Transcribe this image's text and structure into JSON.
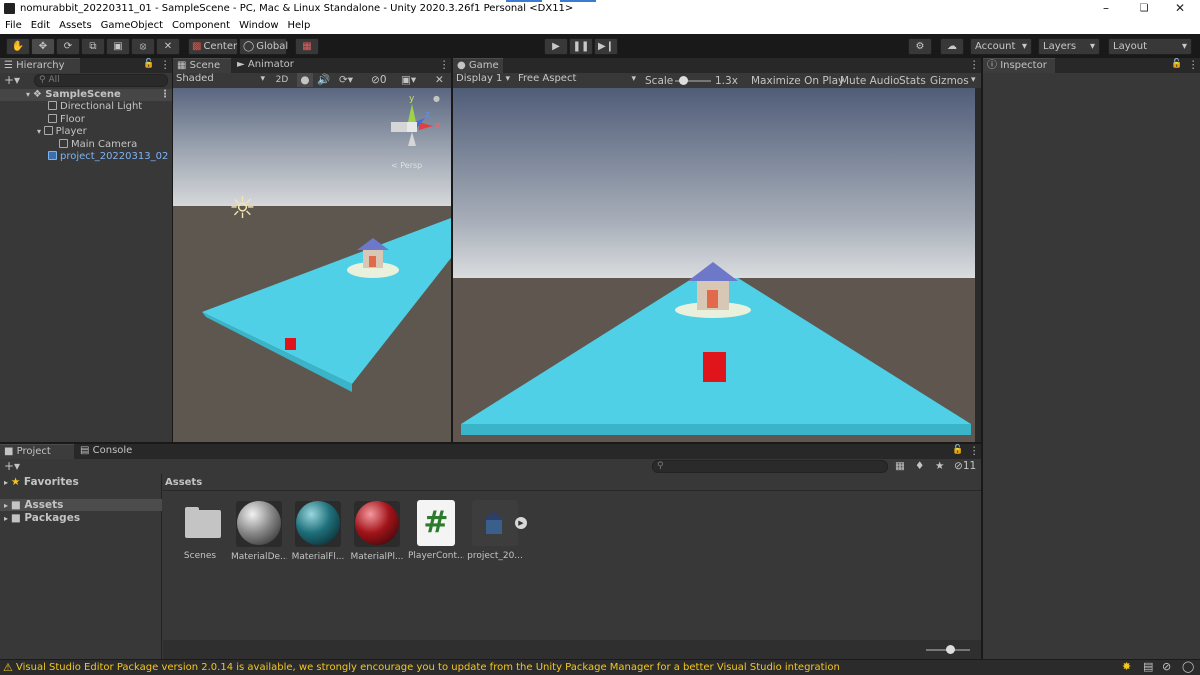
{
  "window": {
    "title": "nomurabbit_20220311_01 - SampleScene - PC, Mac & Linux Standalone - Unity 2020.3.26f1 Personal <DX11>"
  },
  "menu": [
    "File",
    "Edit",
    "Assets",
    "GameObject",
    "Component",
    "Window",
    "Help"
  ],
  "toolbar": {
    "center": "Center",
    "global": "Global",
    "account": "Account",
    "layers": "Layers",
    "layout": "Layout"
  },
  "hierarchy": {
    "tab": "Hierarchy",
    "search_placeholder": "All",
    "items": [
      {
        "label": "SampleScene"
      },
      {
        "label": "Directional Light"
      },
      {
        "label": "Floor"
      },
      {
        "label": "Player"
      },
      {
        "label": "Main Camera"
      },
      {
        "label": "project_20220313_02"
      }
    ]
  },
  "scene": {
    "tabs": [
      "Scene",
      "Animator"
    ],
    "shading": "Shaded",
    "mode2d": "2D",
    "hidden_count": "0",
    "axis_labels": {
      "x": "x",
      "y": "y",
      "z": "z"
    },
    "persp_label": "< Persp"
  },
  "game": {
    "tab": "Game",
    "display": "Display 1",
    "aspect": "Free Aspect",
    "scale_label": "Scale",
    "scale_value": "1.3x",
    "maximize": "Maximize On Play",
    "mute": "Mute Audio",
    "stats": "Stats",
    "gizmos": "Gizmos"
  },
  "inspector": {
    "tab": "Inspector"
  },
  "project": {
    "tabs": [
      "Project",
      "Console"
    ],
    "favorites": "Favorites",
    "tree": [
      "Assets",
      "Packages"
    ],
    "breadcrumb": "Assets",
    "hidden_count": "11",
    "assets": [
      {
        "label": "Scenes",
        "kind": "folder"
      },
      {
        "label": "MaterialDe...",
        "kind": "material",
        "color": "#8a8a8a"
      },
      {
        "label": "MaterialFl...",
        "kind": "material",
        "color": "#1e6f7a"
      },
      {
        "label": "MaterialPl...",
        "kind": "material",
        "color": "#a2141a"
      },
      {
        "label": "PlayerCont...",
        "kind": "script"
      },
      {
        "label": "project_20...",
        "kind": "prefab"
      }
    ]
  },
  "status": {
    "message": "Visual Studio Editor Package version 2.0.14 is available, we strongly encourage you to update from the Unity Package Manager for a better Visual Studio integration"
  },
  "colors": {
    "floor": "#4fd0e6",
    "player": "#e0151b",
    "selected_text": "#7cb3f4",
    "status_warn": "#f3c71f"
  }
}
